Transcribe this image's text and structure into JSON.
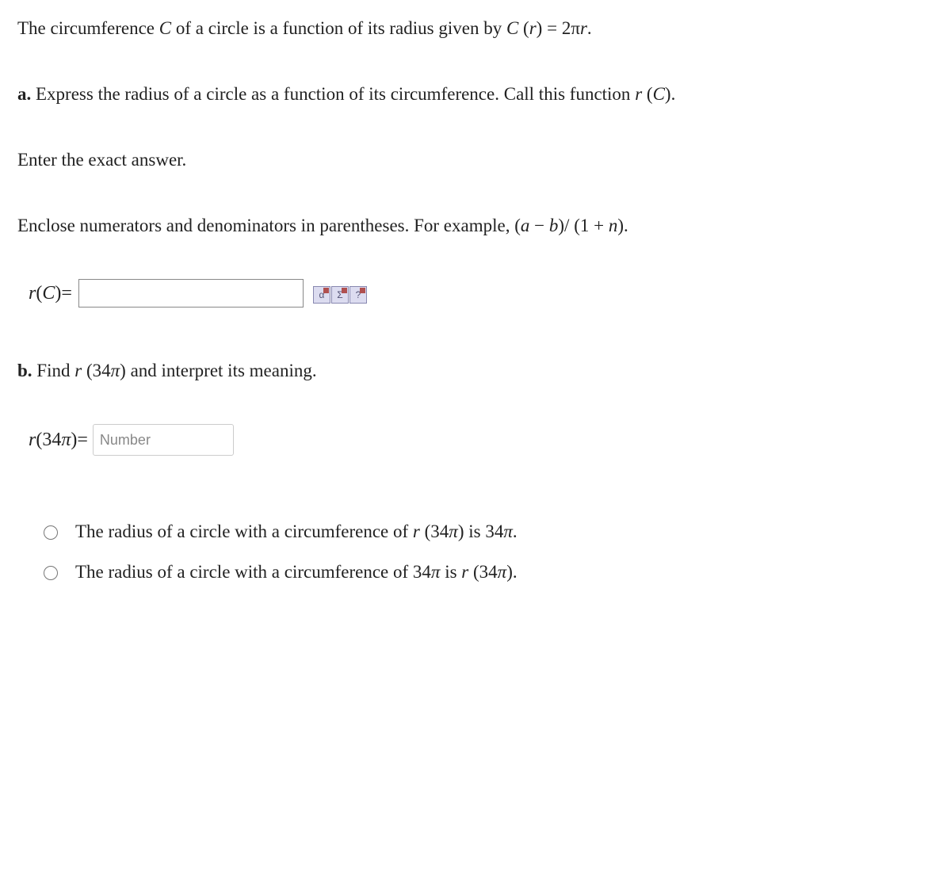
{
  "intro": {
    "pre": "The circumference ",
    "c_var": "C",
    "mid": " of a circle is a function of its radius given by ",
    "formula": "C (r) = 2πr.",
    "c_var2": "C",
    "r_var": "r",
    "eq_text": " = 2π",
    "r_end": "r",
    "period": "."
  },
  "partA": {
    "label": "a.",
    "text": " Express the radius of a circle as a function of its circumference. Call this function ",
    "fn": "r (C)",
    "r": "r",
    "Carg": " (C)",
    "period": "."
  },
  "instruction1": "Enter the exact answer.",
  "instruction2": {
    "pre": "Enclose numerators and denominators in parentheses. For example, ",
    "example": "(a − b)/ (1 + n)",
    "a": "a",
    "minus": " − ",
    "b": "b",
    "close1": ")/",
    "open2": " (1 + ",
    "n": "n",
    "close2": ")",
    "period": "."
  },
  "answerA": {
    "label_r": "r",
    "label_arg": " (C) ",
    "equals": "= "
  },
  "partB": {
    "label": "b.",
    "pre": " Find ",
    "r": "r",
    "arg": " (34π)",
    "post": " and interpret its meaning."
  },
  "answerB": {
    "label_r": "r",
    "label_arg": " (34π) ",
    "equals": "= ",
    "placeholder": "Number"
  },
  "options": {
    "opt1": {
      "pre": "The radius of a circle with a circumference of ",
      "r": "r",
      "arg": " (34π)",
      "mid": " is ",
      "val": "34π",
      "period": "."
    },
    "opt2": {
      "pre": "The radius of a circle with a circumference of ",
      "val": "34π",
      "mid": " is ",
      "r": "r",
      "arg": " (34π)",
      "period": "."
    }
  }
}
